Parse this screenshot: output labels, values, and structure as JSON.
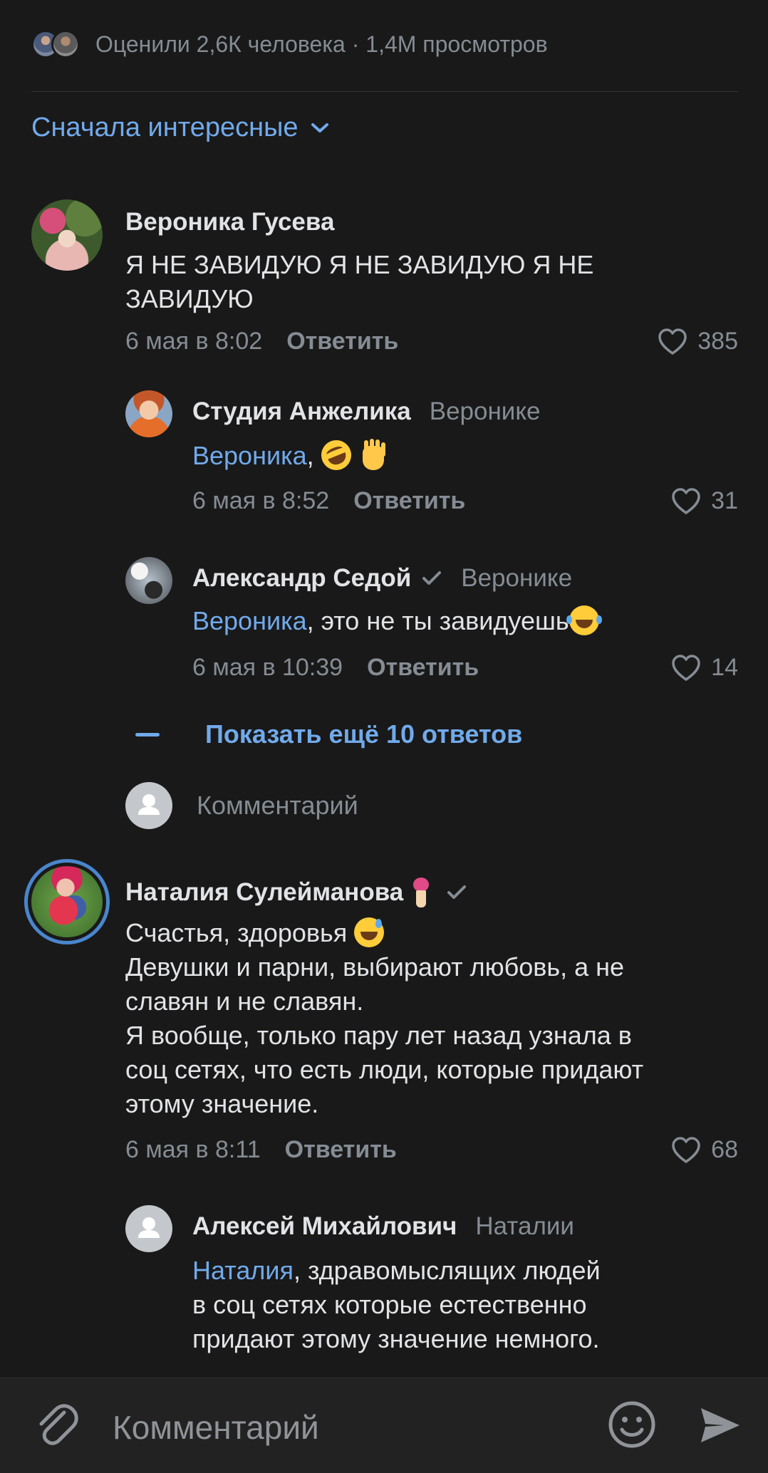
{
  "stats": {
    "text": "Оценили 2,6К человека · 1,4М просмотров"
  },
  "sort": {
    "label": "Сначала интересные"
  },
  "comments": [
    {
      "author": "Вероника Гусева",
      "text": "Я НЕ ЗАВИДУЮ Я НЕ ЗАВИДУЮ Я НЕ ЗАВИДУЮ",
      "date": "6 мая в 8:02",
      "reply_label": "Ответить",
      "likes": "385",
      "replies": [
        {
          "author": "Студия Анжелика",
          "reply_to": "Веронике",
          "mention": "Вероника",
          "text": ",",
          "emojis": [
            "rofl-emoji",
            "raised-hand-emoji"
          ],
          "date": "6 мая в 8:52",
          "reply_label": "Ответить",
          "likes": "31"
        },
        {
          "author": "Александр Седой",
          "reply_to": "Веронике",
          "mention": "Вероника",
          "text": ", это не ты завидуешь",
          "emojis": [
            "joy-emoji"
          ],
          "date": "6 мая в 10:39",
          "reply_label": "Ответить",
          "likes": "14"
        }
      ],
      "show_more": "Показать ещё 10 ответов",
      "inline_comment_placeholder": "Комментарий"
    },
    {
      "author": "Наталия Сулейманова",
      "line1": "Счастья, здоровья",
      "text_lines": [
        "Девушки и парни, выбирают любовь, а не",
        "славян и не славян.",
        "Я вообще, только пару лет назад узнала в",
        "соц сетях, что есть люди, которые придают",
        "этому значение."
      ],
      "date": "6 мая в 8:11",
      "reply_label": "Ответить",
      "likes": "68",
      "replies": [
        {
          "author": "Алексей Михайлович",
          "reply_to": "Наталии",
          "mention": "Наталия",
          "text_lines": [
            ", здравомыслящих людей",
            "в соц сетях которые естественно",
            "придают этому значение немного."
          ]
        }
      ]
    }
  ],
  "composer": {
    "placeholder": "Комментарий"
  },
  "colors": {
    "background": "#191919",
    "accent": "#71aaeb",
    "secondary_text": "#858c94",
    "primary_text": "#e1e3e6"
  }
}
